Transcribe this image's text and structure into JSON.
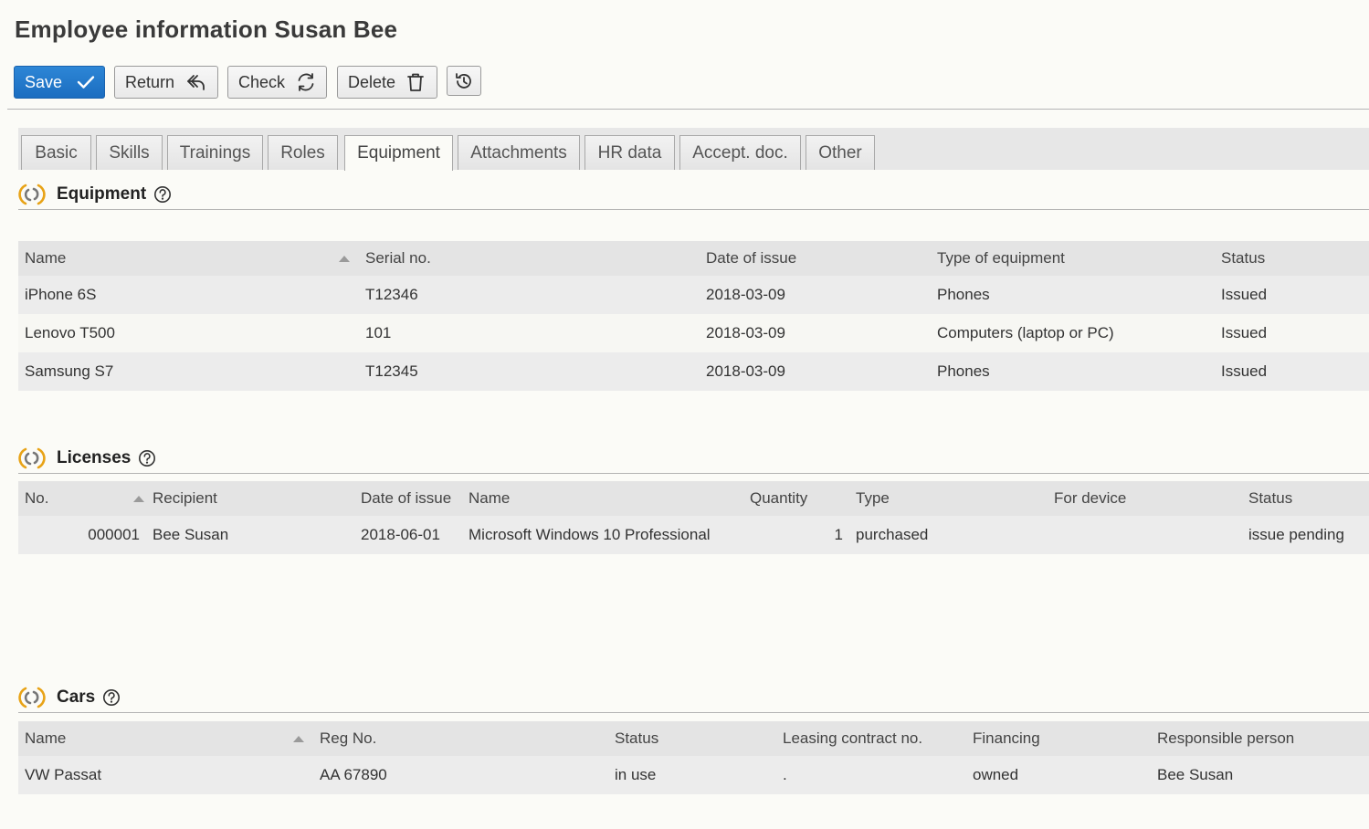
{
  "page": {
    "title": "Employee information Susan Bee"
  },
  "toolbar": {
    "save": "Save",
    "return": "Return",
    "check": "Check",
    "delete": "Delete",
    "history_icon": "history-icon"
  },
  "colors": {
    "primary": "#1b6dc0",
    "section_icon": "#e8a317",
    "tab_strip": "#e7e7e7"
  },
  "tabs": [
    {
      "label": "Basic"
    },
    {
      "label": "Skills"
    },
    {
      "label": "Trainings"
    },
    {
      "label": "Roles"
    },
    {
      "label": "Equipment",
      "active": true
    },
    {
      "label": "Attachments"
    },
    {
      "label": "HR data"
    },
    {
      "label": "Accept. doc."
    },
    {
      "label": "Other"
    }
  ],
  "equipment": {
    "title": "Equipment",
    "columns": [
      "Name",
      "Serial no.",
      "Date of issue",
      "Type of equipment",
      "Status"
    ],
    "rows": [
      [
        "iPhone 6S",
        "T12346",
        "2018-03-09",
        "Phones",
        "Issued"
      ],
      [
        "Lenovo T500",
        "101",
        "2018-03-09",
        "Computers (laptop or PC)",
        "Issued"
      ],
      [
        "Samsung S7",
        "T12345",
        "2018-03-09",
        "Phones",
        "Issued"
      ]
    ]
  },
  "licenses": {
    "title": "Licenses",
    "columns": [
      "No.",
      "Recipient",
      "Date of issue",
      "Name",
      "Quantity",
      "Type",
      "For device",
      "Status"
    ],
    "rows": [
      [
        "000001",
        "Bee Susan",
        "2018-06-01",
        "Microsoft Windows 10 Professional",
        "1",
        "purchased",
        "",
        "issue pending"
      ]
    ]
  },
  "cars": {
    "title": "Cars",
    "columns": [
      "Name",
      "Reg No.",
      "Status",
      "Leasing contract no.",
      "Financing",
      "Responsible person"
    ],
    "rows": [
      [
        "VW Passat",
        "AA 67890",
        "in use",
        ".",
        "owned",
        "Bee Susan"
      ]
    ]
  }
}
